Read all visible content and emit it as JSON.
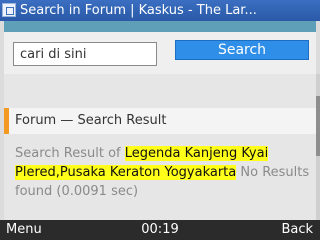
{
  "window": {
    "title": "Search in Forum | Kaskus - The Lar...",
    "icon": "window-icon"
  },
  "search": {
    "value": "cari di sini",
    "button_label": "Search"
  },
  "section": {
    "title": "Forum — Search Result"
  },
  "result": {
    "prefix": "Search Result of ",
    "query": "Legenda Kanjeng Kyai Plered,Pusaka Keraton Yogyakarta",
    "suffix": " No Results found (0.0091 sec)"
  },
  "softkeys": {
    "left": "Menu",
    "clock": "00:19",
    "right": "Back"
  },
  "colors": {
    "titlebar": "#2f62b5",
    "accent": "#f39a24",
    "button": "#2f8fe8",
    "highlight": "#ffff1a"
  }
}
